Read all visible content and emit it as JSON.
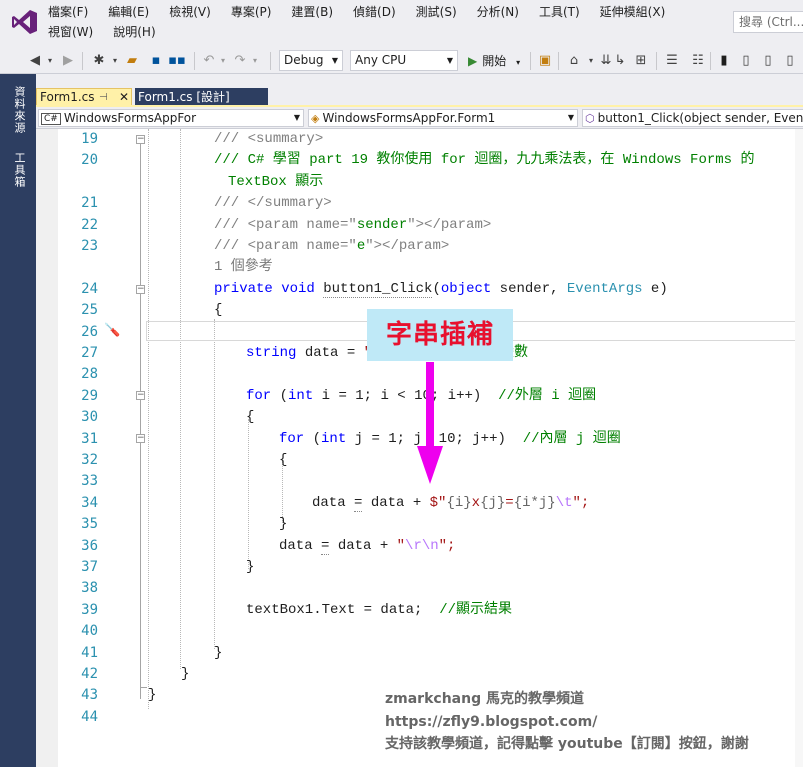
{
  "menu": {
    "items": [
      "檔案(F)",
      "編輯(E)",
      "檢視(V)",
      "專案(P)",
      "建置(B)",
      "偵錯(D)",
      "測試(S)",
      "分析(N)",
      "工具(T)",
      "延伸模組(X)",
      "視窗(W)",
      "說明(H)"
    ],
    "search_placeholder": "搜尋 (Ctrl..."
  },
  "toolbar": {
    "config": "Debug",
    "platform": "Any CPU",
    "start_label": "開始"
  },
  "dock": {
    "left_tabs": [
      "資料來源",
      "工具箱"
    ]
  },
  "tabs": {
    "active": "Form1.cs",
    "other": "Form1.cs [設計]"
  },
  "nav": {
    "project": "WindowsFormsAppFor",
    "class": "WindowsFormsAppFor.Form1",
    "member": "button1_Click(object sender, EventA",
    "project_icon": "C#"
  },
  "editor": {
    "line_numbers": [
      "19",
      "20",
      "",
      "21",
      "22",
      "23",
      "",
      "24",
      "25",
      "26",
      "27",
      "28",
      "29",
      "30",
      "31",
      "32",
      "33",
      "34",
      "35",
      "36",
      "37",
      "38",
      "39",
      "40",
      "41",
      "42",
      "43",
      "44"
    ],
    "lines": {
      "l19": [
        "/// ",
        "<summary>"
      ],
      "l20a": "/// C# 學習 part 19 教你使用 for 迴圈，九九乘法表，在 Windows Forms 的",
      "l20b": "TextBox 顯示",
      "l21": [
        "/// ",
        "</summary>"
      ],
      "l22": [
        "/// ",
        "<param name=\"",
        "sender",
        "\"></param>"
      ],
      "l23": [
        "/// ",
        "<param name=\"",
        "e",
        "\"></param>"
      ],
      "refs": "1 個參考",
      "l24": [
        "private",
        " ",
        "void",
        " ",
        "button1_Click",
        "(",
        "object",
        " sender, ",
        "EventArgs",
        " e)"
      ],
      "l25": "{",
      "l27": [
        "string",
        " data = ",
        "\"",
        "類型的變數"
      ],
      "l29": [
        "for",
        " (",
        "int",
        " i = 1; i < 10",
        "; i++)  ",
        "//外層 i 迴圈"
      ],
      "l30": "{",
      "l31": [
        "for",
        " (",
        "int",
        " j = 1; j",
        "  10; j++)  ",
        "//內層 j 迴圈"
      ],
      "l32": "{",
      "l34": [
        "data ",
        "=",
        " data + ",
        "$\"",
        "{i}",
        "x",
        "{j}",
        "=",
        "{i*j}",
        "\\t",
        "\";"
      ],
      "l35": "}",
      "l36": [
        "data ",
        "=",
        " data + ",
        "\"",
        "\\r\\n",
        "\";"
      ],
      "l37": "}",
      "l39": [
        "textBox1.Text = data;  ",
        "//顯示結果"
      ],
      "l41": "}",
      "l42": "}",
      "l43": "}"
    }
  },
  "annotation": {
    "callout": "字串插補"
  },
  "watermark": {
    "line1": "zmarkchang 馬克的教學頻道",
    "line2": "https://zfly9.blogspot.com/",
    "line3": "支持該教學頻道，記得點擊 youtube【訂閱】按鈕，謝謝"
  },
  "colors": {
    "comment": "#008000",
    "xml_tag": "#808080",
    "keyword": "#0000ff",
    "type": "#2b91af",
    "string": "#a31515",
    "escape": "#b776fb",
    "dock": "#2d3e61",
    "active_tab": "#fff1a8",
    "callout_bg": "#bfe9f7",
    "callout_text": "#e8102e",
    "arrow": "#ee00ee"
  }
}
